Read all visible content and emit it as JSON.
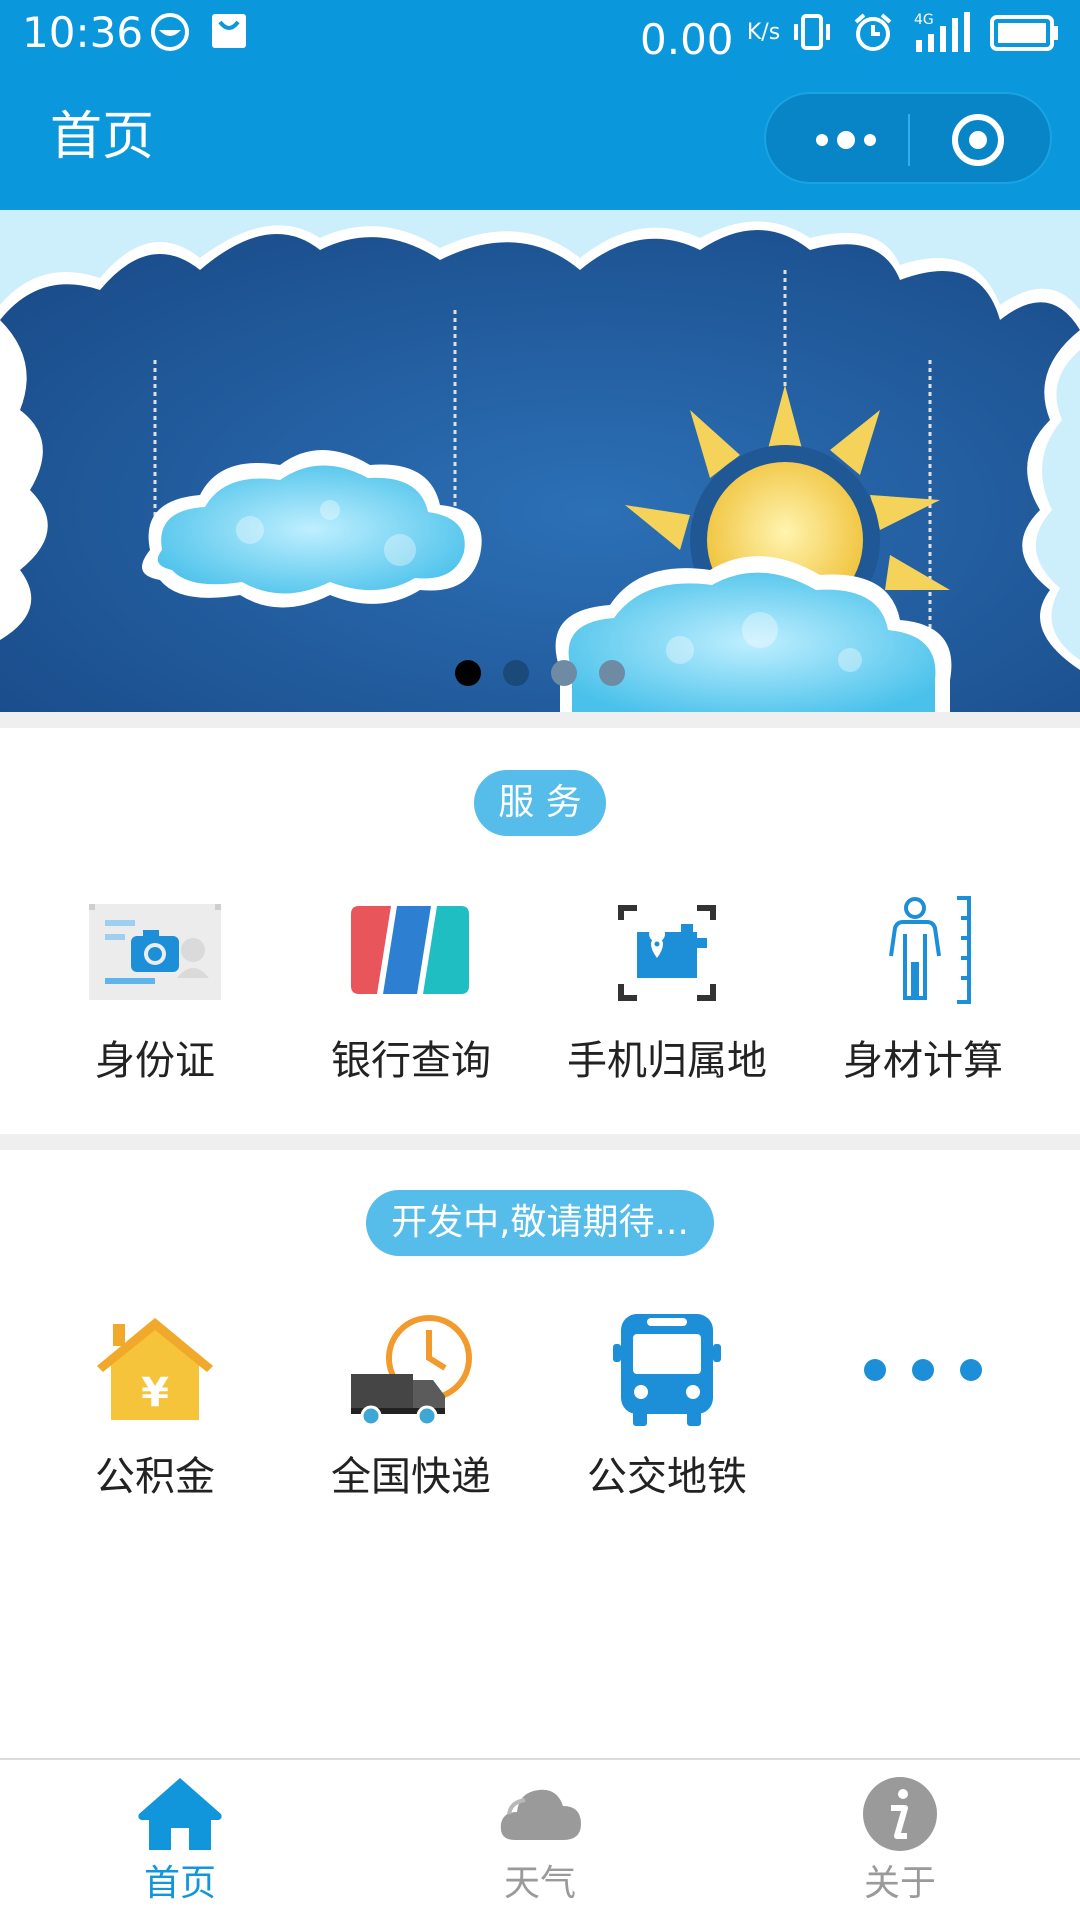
{
  "status_bar": {
    "time": "10:36",
    "net_speed": "0.00",
    "net_unit": "K/s",
    "network": "4G"
  },
  "nav": {
    "title": "首页"
  },
  "banner": {
    "slide_count": 4,
    "active_index": 0
  },
  "services": {
    "heading": "服 务",
    "items": [
      {
        "label": "身份证",
        "icon": "id-card-icon"
      },
      {
        "label": "银行查询",
        "icon": "bank-card-icon"
      },
      {
        "label": "手机归属地",
        "icon": "phone-location-icon"
      },
      {
        "label": "身材计算",
        "icon": "body-measure-icon"
      }
    ]
  },
  "developing": {
    "heading": "开发中,敬请期待...",
    "items": [
      {
        "label": "公积金",
        "icon": "housing-fund-icon"
      },
      {
        "label": "全国快递",
        "icon": "express-truck-icon"
      },
      {
        "label": "公交地铁",
        "icon": "bus-icon"
      },
      {
        "label": "",
        "icon": "more-dots-icon"
      }
    ]
  },
  "tabs": [
    {
      "label": "首页",
      "icon": "home-icon",
      "active": true
    },
    {
      "label": "天气",
      "icon": "cloud-icon",
      "active": false
    },
    {
      "label": "关于",
      "icon": "info-icon",
      "active": false
    }
  ],
  "colors": {
    "primary": "#0a97dc",
    "pill": "#56bce9",
    "tab_active": "#1296db",
    "tab_inactive": "#9a9a9a"
  }
}
